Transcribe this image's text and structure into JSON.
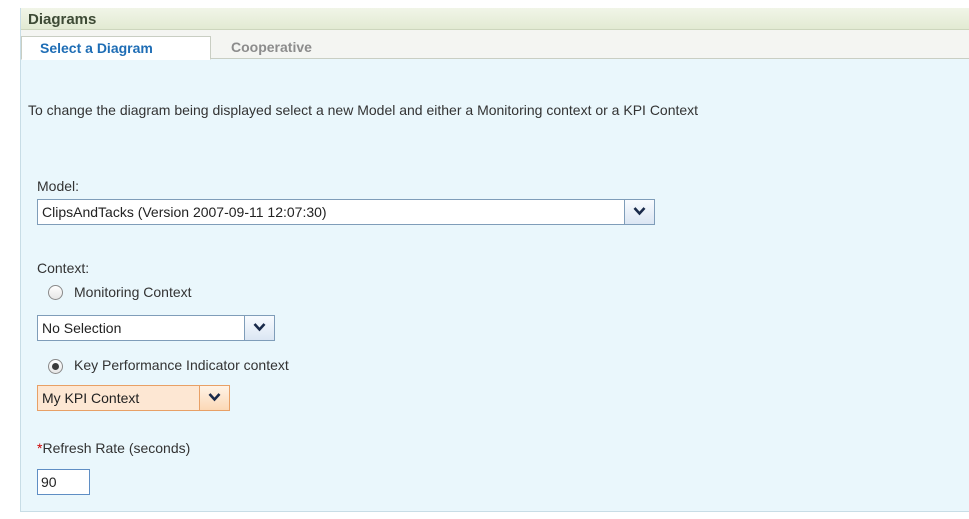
{
  "portlet": {
    "title": "Diagrams"
  },
  "tabs": [
    {
      "label": "Select a Diagram",
      "active": true
    },
    {
      "label": "Cooperative",
      "active": false
    }
  ],
  "instructions": "To change the diagram being displayed select a new Model and either a Monitoring context or a KPI Context",
  "model": {
    "label": "Model:",
    "value": "ClipsAndTacks (Version 2007-09-11 12:07:30)"
  },
  "context": {
    "label": "Context:",
    "monitoring": {
      "label": "Monitoring Context",
      "selected": false,
      "value": "No Selection"
    },
    "kpi": {
      "label": "Key Performance Indicator context",
      "selected": true,
      "value": "My KPI Context"
    }
  },
  "refresh": {
    "required_mark": "*",
    "label": "Refresh Rate (seconds)",
    "value": "90"
  },
  "icons": {
    "dropdown": "chevron-down-icon"
  },
  "colors": {
    "tab_active_text": "#1e6db5",
    "content_bg": "#eaf7fc",
    "kpi_highlight": "#fde7d3",
    "required": "#cc0000"
  }
}
